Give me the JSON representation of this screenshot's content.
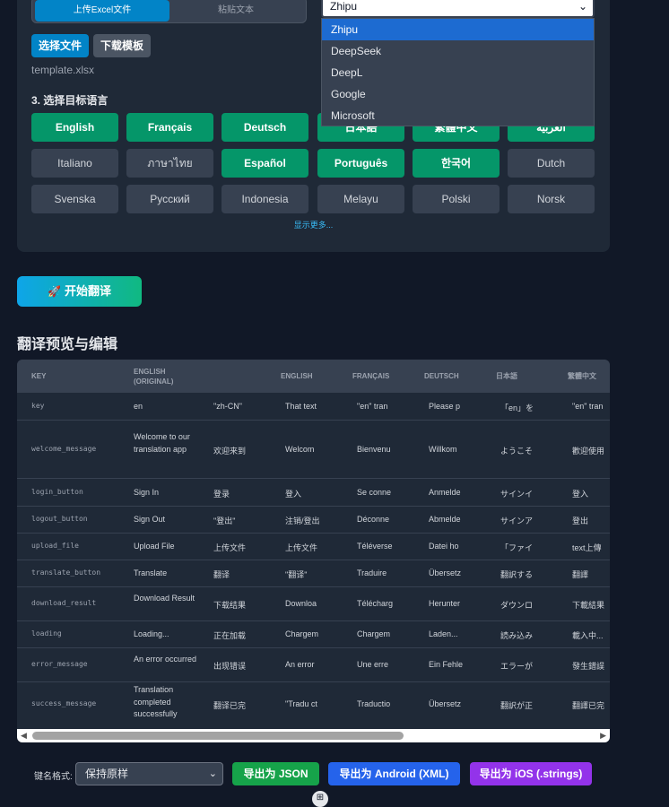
{
  "upload": {
    "tab_excel": "上传Excel文件",
    "tab_paste": "粘贴文本",
    "choose_file": "选择文件",
    "download_template": "下载模板",
    "file_name": "template.xlsx"
  },
  "engine": {
    "selected": "Zhipu",
    "options": [
      "Zhipu",
      "DeepSeek",
      "DeepL",
      "Google",
      "Microsoft"
    ]
  },
  "languages": {
    "title": "3. 选择目标语言",
    "items": [
      {
        "label": "English",
        "selected": true
      },
      {
        "label": "Français",
        "selected": true
      },
      {
        "label": "Deutsch",
        "selected": true
      },
      {
        "label": "日本語",
        "selected": true
      },
      {
        "label": "繁體中文",
        "selected": true
      },
      {
        "label": "العربية",
        "selected": true
      },
      {
        "label": "Italiano",
        "selected": false
      },
      {
        "label": "ภาษาไทย",
        "selected": false
      },
      {
        "label": "Español",
        "selected": true
      },
      {
        "label": "Português",
        "selected": true
      },
      {
        "label": "한국어",
        "selected": true
      },
      {
        "label": "Dutch",
        "selected": false
      },
      {
        "label": "Svenska",
        "selected": false
      },
      {
        "label": "Русский",
        "selected": false
      },
      {
        "label": "Indonesia",
        "selected": false
      },
      {
        "label": "Melayu",
        "selected": false
      },
      {
        "label": "Polski",
        "selected": false
      },
      {
        "label": "Norsk",
        "selected": false
      }
    ],
    "show_more": "显示更多..."
  },
  "start_button": {
    "icon": "rocket-icon",
    "label": "开始翻译"
  },
  "preview": {
    "title": "翻译预览与编辑",
    "headers": [
      "KEY",
      "ENGLISH (ORIGINAL)",
      "",
      "ENGLISH",
      "FRANÇAIS",
      "DEUTSCH",
      "日本語",
      "繁體中文"
    ],
    "rows": [
      [
        "key",
        "en",
        "\"zh-CN\"",
        "That text",
        "\"en\" tran",
        "Please p",
        "「en」を",
        "\"en\" tran"
      ],
      [
        "welcome_message",
        "Welcome to our translation app",
        "欢迎来到",
        "Welcom",
        "Bienvenu",
        "Willkom",
        "ようこそ",
        "歡迎使用"
      ],
      [
        "login_button",
        "Sign In",
        "登录",
        "登入",
        "Se conne",
        "Anmelde",
        "サインイ",
        "登入"
      ],
      [
        "logout_button",
        "Sign Out",
        "\"登出\"",
        "注销/登出",
        "Déconne",
        "Abmelde",
        "サインア",
        "登出"
      ],
      [
        "upload_file",
        "Upload File",
        "上传文件",
        "上传文件",
        "Téléverse",
        "Datei ho",
        "「ファイ",
        "text上傳"
      ],
      [
        "translate_button",
        "Translate",
        "翻译",
        "\"翻译\"",
        "Traduire",
        "Übersetz",
        "翻訳する",
        "翻譯"
      ],
      [
        "download_result",
        "Download Result",
        "下载结果",
        "Downloa",
        "Télécharg",
        "Herunter",
        "ダウンロ",
        "下載結果"
      ],
      [
        "loading",
        "Loading...",
        "正在加载",
        "Chargem",
        "Chargem",
        "Laden...",
        "読み込み",
        "載入中..."
      ],
      [
        "error_message",
        "An error occurred",
        "出现错误",
        "An error",
        "Une erre",
        "Ein Fehle",
        "エラーが",
        "發生錯誤"
      ],
      [
        "success_message",
        "Translation completed successfully",
        "翻译已完",
        "\"Tradu ct",
        "Traductio",
        "Übersetz",
        "翻訳が正",
        "翻譯已完"
      ]
    ]
  },
  "export": {
    "key_format_label": "键名格式:",
    "key_format_value": "保持原样",
    "json": "导出为 JSON",
    "android": "导出为 Android (XML)",
    "ios": "导出为 iOS (.strings)"
  },
  "colors": {
    "bg": "#111827",
    "panel": "#1f2937",
    "selected_lang": "#059669",
    "json_btn": "#16a34a",
    "android_btn": "#2563eb",
    "ios_btn": "#9333ea"
  }
}
